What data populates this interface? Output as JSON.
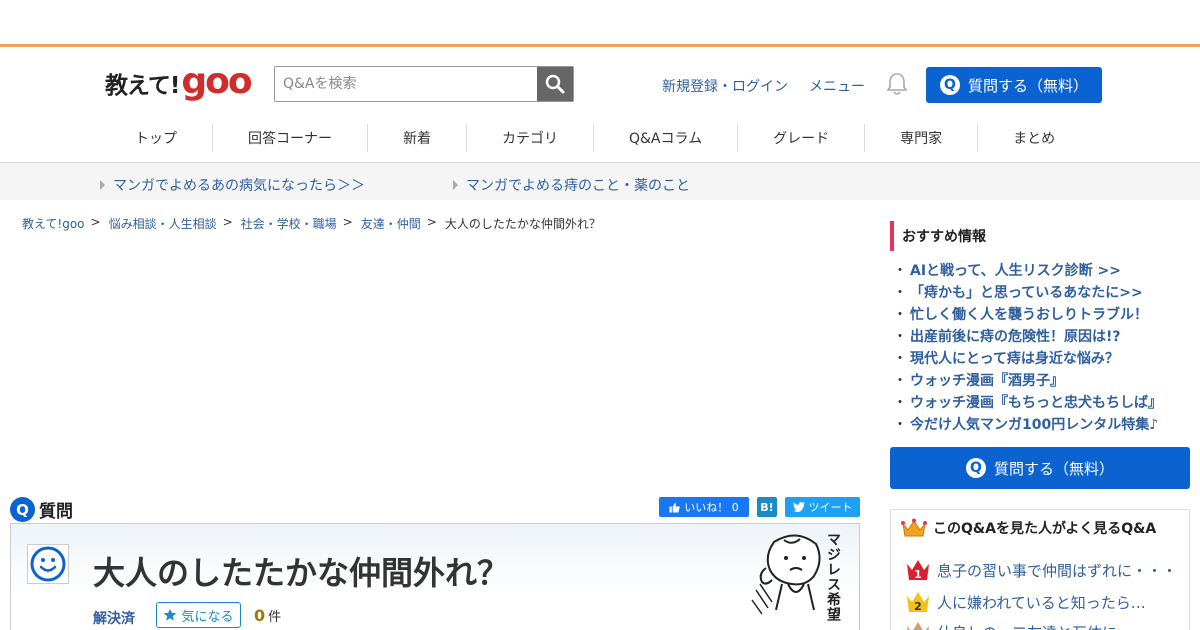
{
  "header": {
    "logo_text": "教えて!",
    "logo_brand": "goo",
    "search_placeholder": "Q&Aを検索",
    "signup_login": "新規登録・ログイン",
    "menu": "メニュー",
    "ask_button": "質問する（無料）"
  },
  "nav": [
    "トップ",
    "回答コーナー",
    "新着",
    "カテゴリ",
    "Q&Aコラム",
    "グレード",
    "専門家",
    "まとめ"
  ],
  "promos": [
    "マンガでよめるあの病気になったら＞＞",
    "マンガでよめる痔のこと・薬のこと"
  ],
  "breadcrumb": {
    "items": [
      "教えて!goo",
      "悩み相談・人生相談",
      "社会・学校・職場",
      "友達・仲間"
    ],
    "sep": ">",
    "current": "大人のしたたかな仲間外れ？"
  },
  "question": {
    "section_label": "質問",
    "q_mark": "Q",
    "title": "大人のしたたかな仲間外れ？",
    "status": "解決済",
    "watch_label": "気になる",
    "count": "0",
    "count_unit": "件",
    "stamp_text": "マジレス希望"
  },
  "share": {
    "like": "いいね！ 0",
    "hatena": "B!",
    "tweet": "ツイート"
  },
  "sidebar": {
    "title": "おすすめ情報",
    "items": [
      "AIと戦って、人生リスク診断 >>",
      "「痔かも」と思っているあなたに>>",
      "忙しく働く人を襲うおしりトラブル！",
      "出産前後に痔の危険性！原因は!?",
      "現代人にとって痔は身近な悩み？",
      "ウォッチ漫画『酒男子』",
      "ウォッチ漫画『もちっと忠犬もちしば』",
      "今だけ人気マンガ100円レンタル特集♪"
    ],
    "ask_button": "質問する（無料）",
    "rank_title": "このQ&Aを見た人がよく見るQ&A",
    "rank_items": [
      "息子の習い事で仲間はずれに・・・",
      "人に嫌われていると知ったら…",
      "仕良しの一二友達と互体に"
    ]
  },
  "colors": {
    "accent_blue": "#0a63d1",
    "link": "#2f5f9f",
    "brand_red": "#d12b2b",
    "header_line": "#f6a15a",
    "side_marker": "#e8345a"
  }
}
